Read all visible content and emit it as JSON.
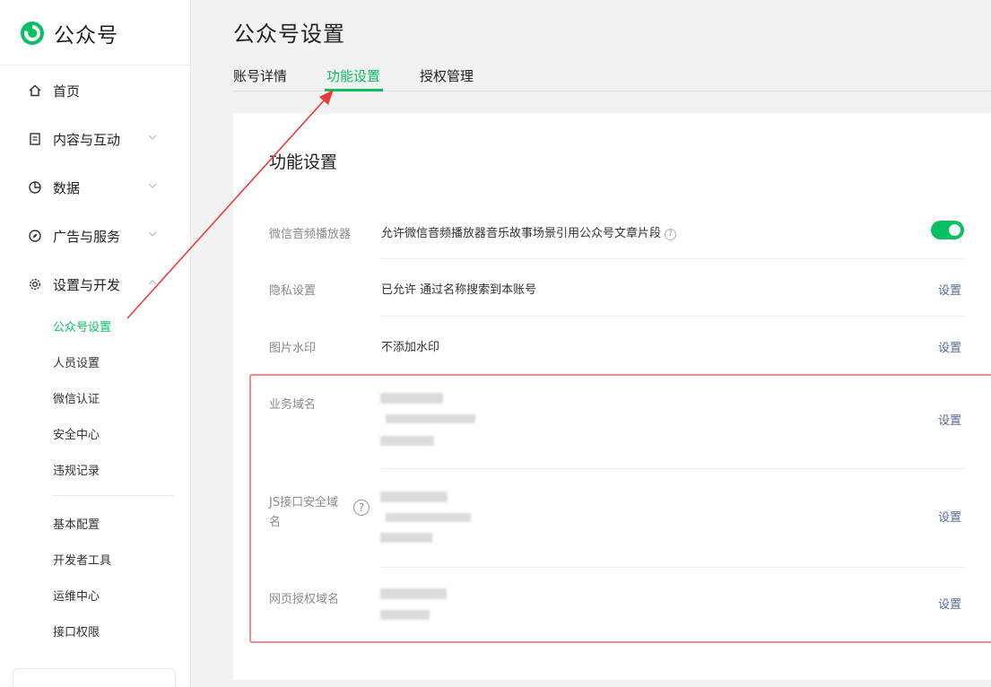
{
  "app": {
    "name": "公众号"
  },
  "colors": {
    "accent": "#07c160",
    "link": "#576b95",
    "annotation": "#ee3a3a"
  },
  "sidebar": {
    "menu": [
      {
        "label": "首页",
        "icon": "home-icon"
      },
      {
        "label": "内容与互动",
        "icon": "document-icon"
      },
      {
        "label": "数据",
        "icon": "pie-chart-icon"
      },
      {
        "label": "广告与服务",
        "icon": "compass-icon"
      },
      {
        "label": "设置与开发",
        "icon": "gear-icon"
      }
    ],
    "settings_sub": [
      "公众号设置",
      "人员设置",
      "微信认证",
      "安全中心",
      "违规记录"
    ],
    "dev_sub": [
      "基本配置",
      "开发者工具",
      "运维中心",
      "接口权限"
    ]
  },
  "main": {
    "title": "公众号设置",
    "tabs": [
      "账号详情",
      "功能设置",
      "授权管理"
    ]
  },
  "card": {
    "title": "功能设置",
    "rows": [
      {
        "label": "微信音频播放器",
        "value": "允许微信音频播放器音乐故事场景引用公众号文章片段",
        "action": ""
      },
      {
        "label": "隐私设置",
        "value": "已允许 通过名称搜索到本账号",
        "action": "设置"
      },
      {
        "label": "图片水印",
        "value": "不添加水印",
        "action": "设置"
      },
      {
        "label": "业务域名",
        "value": "",
        "action": "设置"
      },
      {
        "label": "JS接口安全域名",
        "value": "",
        "action": "设置"
      },
      {
        "label": "网页授权域名",
        "value": "",
        "action": "设置"
      }
    ],
    "audio_toggle_on": true
  }
}
